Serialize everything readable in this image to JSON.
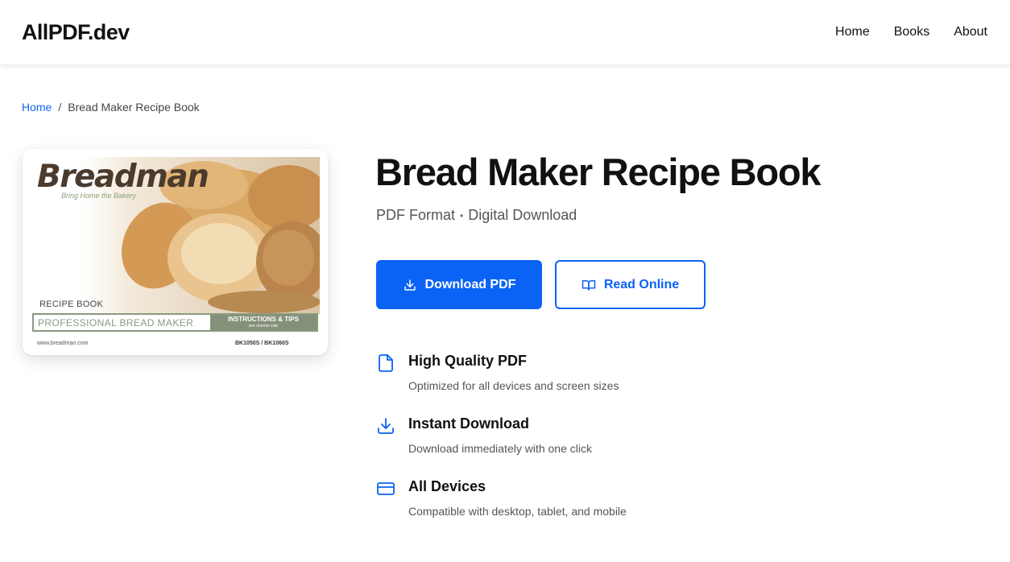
{
  "header": {
    "logo": "AllPDF.dev",
    "nav": [
      "Home",
      "Books",
      "About"
    ]
  },
  "breadcrumb": {
    "home": "Home",
    "separator": "/",
    "current": "Bread Maker Recipe Book"
  },
  "cover": {
    "brand": "Breadman",
    "tagline": "Bring Home the Bakery",
    "label": "RECIPE BOOK",
    "bar_left": "PROFESSIONAL BREAD MAKER",
    "bar_right": "INSTRUCTIONS & TIPS",
    "bar_right_sub": "see reverse side",
    "website": "www.breadman.com",
    "models": "BK1050S / BK1060S"
  },
  "book": {
    "title": "Bread Maker Recipe Book",
    "format": "PDF Format",
    "dot": "•",
    "delivery": "Digital Download"
  },
  "actions": {
    "download_label": "Download PDF",
    "read_label": "Read Online"
  },
  "features": [
    {
      "title": "High Quality PDF",
      "desc": "Optimized for all devices and screen sizes",
      "icon": "file-icon"
    },
    {
      "title": "Instant Download",
      "desc": "Download immediately with one click",
      "icon": "download-icon"
    },
    {
      "title": "All Devices",
      "desc": "Compatible with desktop, tablet, and mobile",
      "icon": "card-icon"
    }
  ],
  "colors": {
    "accent": "#0a63f5",
    "link": "#1463f3"
  }
}
